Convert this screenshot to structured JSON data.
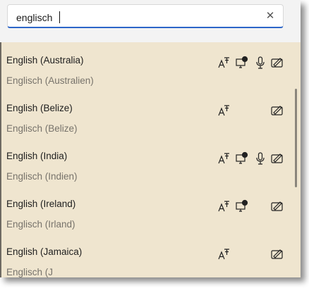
{
  "search": {
    "value": "englisch",
    "clear_icon": "✕"
  },
  "languages": [
    {
      "name": "English (Australia)",
      "local": "Englisch (Australien)",
      "features": [
        "font-icon",
        "screen-icon",
        "mic-icon",
        "handwriting-icon"
      ]
    },
    {
      "name": "English (Belize)",
      "local": "Englisch (Belize)",
      "features": [
        "font-icon",
        "handwriting-icon"
      ]
    },
    {
      "name": "English (India)",
      "local": "Englisch (Indien)",
      "features": [
        "font-icon",
        "screen-icon",
        "mic-icon",
        "handwriting-icon"
      ]
    },
    {
      "name": "English (Ireland)",
      "local": "Englisch (Irland)",
      "features": [
        "font-icon",
        "screen-icon",
        "handwriting-icon"
      ]
    },
    {
      "name": "English (Jamaica)",
      "local": "Englisch (J",
      "features": [
        "font-icon",
        "handwriting-icon"
      ]
    }
  ],
  "colors": {
    "list_bg": "#efe5cf",
    "accent": "#2c66c9",
    "secondary_text": "#77736b"
  }
}
